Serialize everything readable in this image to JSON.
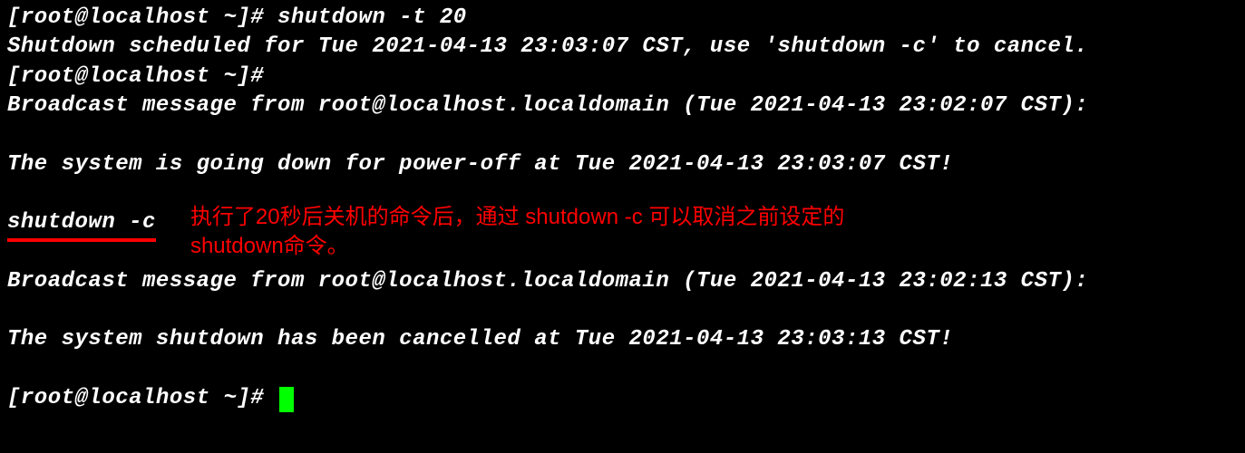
{
  "terminal": {
    "prompt": "[root@localhost ~]# ",
    "commands": {
      "shutdown_schedule": "shutdown -t 20",
      "shutdown_cancel": "shutdown -c"
    },
    "output": {
      "scheduled": "Shutdown scheduled for Tue 2021-04-13 23:03:07 CST, use 'shutdown -c' to cancel.",
      "broadcast1": "Broadcast message from root@localhost.localdomain (Tue 2021-04-13 23:02:07 CST):",
      "going_down": "The system is going down for power-off at Tue 2021-04-13 23:03:07 CST!",
      "broadcast2": "Broadcast message from root@localhost.localdomain (Tue 2021-04-13 23:02:13 CST):",
      "cancelled": "The system shutdown has been cancelled at Tue 2021-04-13 23:03:13 CST!"
    }
  },
  "annotation": {
    "line1": "执行了20秒后关机的命令后，通过 shutdown -c 可以取消之前设定的",
    "line2": "shutdown命令。"
  }
}
